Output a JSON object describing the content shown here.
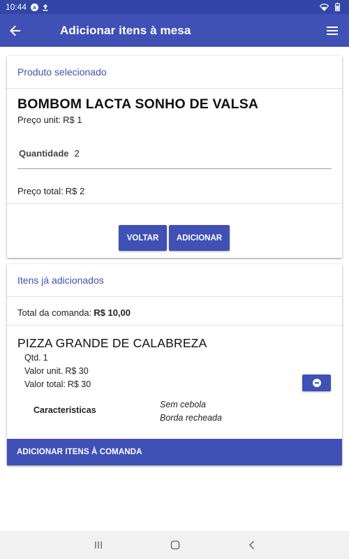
{
  "statusbar": {
    "time": "10:44"
  },
  "appbar": {
    "title": "Adicionar itens à mesa"
  },
  "selected": {
    "header": "Produto selecionado",
    "product_name": "BOMBOM LACTA SONHO DE VALSA",
    "unit_price_label": "Preço unit:",
    "unit_price": "R$ 1",
    "quantity_label": "Quantidade",
    "quantity": "2",
    "total_price_label": "Preço total:",
    "total_price": "R$ 2",
    "back_button": "VOLTAR",
    "add_button": "ADICIONAR"
  },
  "added": {
    "header": "Itens já adicionados",
    "total_label": "Total da comanda:",
    "total_value": "R$ 10,00",
    "items": [
      {
        "name": "PIZZA GRANDE DE CALABREZA",
        "qtd_label": "Qtd.",
        "qtd": "1",
        "unit_label": "Valor unit.",
        "unit_value": "R$ 30",
        "total_label": "Valor total:",
        "total_value": "R$ 30",
        "characteristics_label": "Características",
        "characteristics": [
          "Sem cebola",
          "Borda recheada"
        ]
      }
    ],
    "add_to_tab_button": "ADICIONAR ITENS À COMANDA"
  },
  "colors": {
    "primary": "#3f51b5",
    "statusbar": "#3246a6"
  },
  "icons": [
    "arrow-back-icon",
    "menu-icon",
    "remove-circle-icon",
    "recents-icon",
    "home-icon",
    "nav-back-icon",
    "wifi-icon",
    "battery-icon"
  ]
}
